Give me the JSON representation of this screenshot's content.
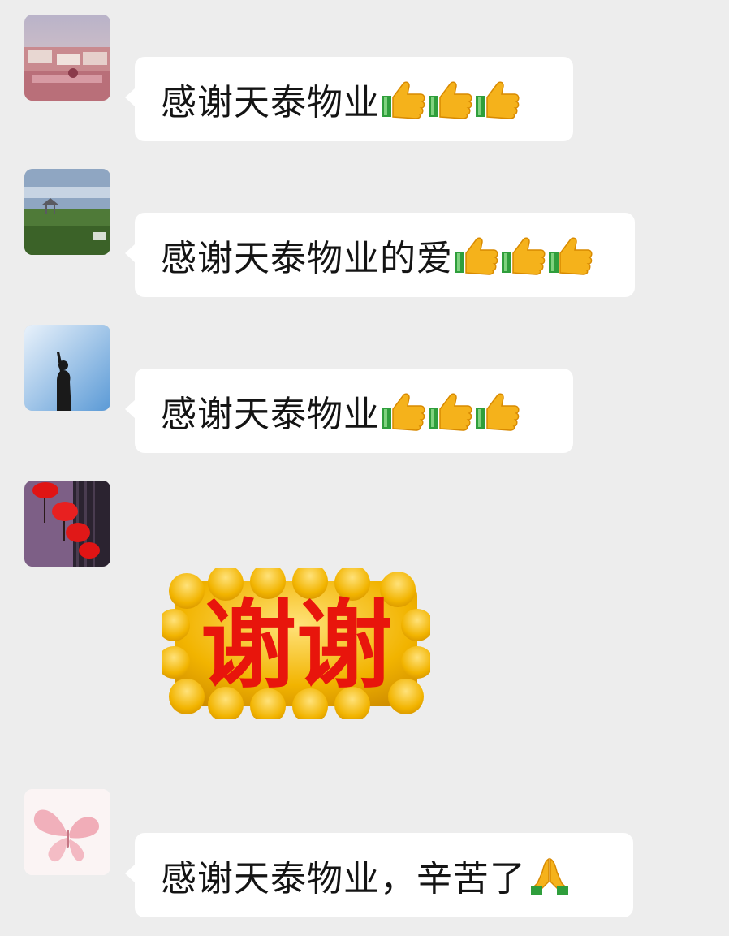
{
  "chat": {
    "messages": [
      {
        "sender": "",
        "text": "感谢天泰物业",
        "emojis": [
          "thumbs-up",
          "thumbs-up",
          "thumbs-up"
        ]
      },
      {
        "sender": "",
        "text": "感谢天泰物业的爱",
        "emojis": [
          "thumbs-up",
          "thumbs-up",
          "thumbs-up"
        ]
      },
      {
        "sender": "",
        "text": "感谢天泰物业",
        "emojis": [
          "thumbs-up",
          "thumbs-up",
          "thumbs-up"
        ]
      },
      {
        "sender": "",
        "sticker_text": "谢谢"
      },
      {
        "sender": "",
        "text": "感谢天泰物业，辛苦了",
        "emojis": [
          "folded-hands"
        ]
      }
    ]
  },
  "colors": {
    "background": "#ededed",
    "bubble": "#ffffff",
    "sticker_text": "#e8150c",
    "sticker_bg": "#f2b400"
  }
}
